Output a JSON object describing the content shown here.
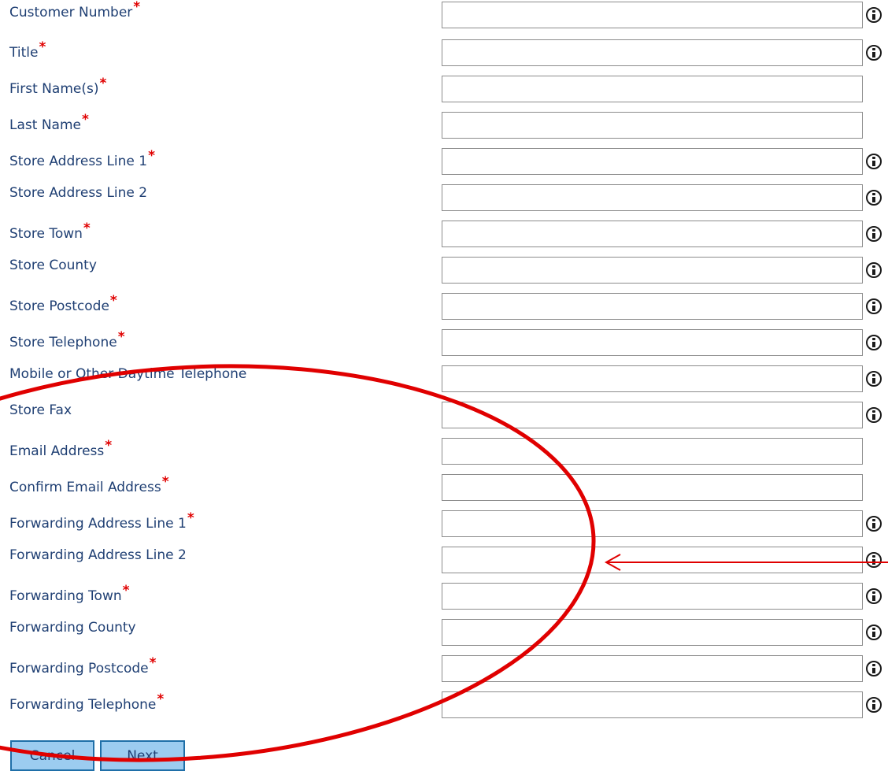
{
  "fields": [
    {
      "label": "Customer Number",
      "required": true,
      "info": true,
      "value": ""
    },
    {
      "label": "Title",
      "required": true,
      "info": true,
      "value": ""
    },
    {
      "label": "First Name(s)",
      "required": true,
      "info": false,
      "value": ""
    },
    {
      "label": "Last Name",
      "required": true,
      "info": false,
      "value": ""
    },
    {
      "label": "Store Address Line 1",
      "required": true,
      "info": true,
      "value": ""
    },
    {
      "label": "Store Address Line 2",
      "required": false,
      "info": true,
      "value": ""
    },
    {
      "label": "Store Town",
      "required": true,
      "info": true,
      "value": ""
    },
    {
      "label": "Store County",
      "required": false,
      "info": true,
      "value": ""
    },
    {
      "label": "Store Postcode",
      "required": true,
      "info": true,
      "value": ""
    },
    {
      "label": "Store Telephone",
      "required": true,
      "info": true,
      "value": ""
    },
    {
      "label": "Mobile or Other Daytime Telephone",
      "required": false,
      "info": true,
      "value": ""
    },
    {
      "label": "Store Fax",
      "required": false,
      "info": true,
      "value": ""
    },
    {
      "label": "Email Address",
      "required": true,
      "info": false,
      "value": ""
    },
    {
      "label": "Confirm Email Address",
      "required": true,
      "info": false,
      "value": ""
    },
    {
      "label": "Forwarding Address Line 1",
      "required": true,
      "info": true,
      "value": ""
    },
    {
      "label": "Forwarding Address Line 2",
      "required": false,
      "info": true,
      "value": ""
    },
    {
      "label": "Forwarding Town",
      "required": true,
      "info": true,
      "value": ""
    },
    {
      "label": "Forwarding County",
      "required": false,
      "info": true,
      "value": ""
    },
    {
      "label": "Forwarding Postcode",
      "required": true,
      "info": true,
      "value": ""
    },
    {
      "label": "Forwarding Telephone",
      "required": true,
      "info": true,
      "value": ""
    }
  ],
  "required_marker": "*",
  "buttons": {
    "cancel": "Cancel",
    "next": "Next"
  },
  "annotation": {
    "shapes": [
      "ellipse",
      "arrow"
    ],
    "color": "#e00000"
  },
  "colors": {
    "label": "#1f3f73",
    "required": "#e00000",
    "button_bg": "#9cccf0",
    "button_border": "#1f6fa8"
  },
  "icons": {
    "info": "info-circle-icon"
  }
}
